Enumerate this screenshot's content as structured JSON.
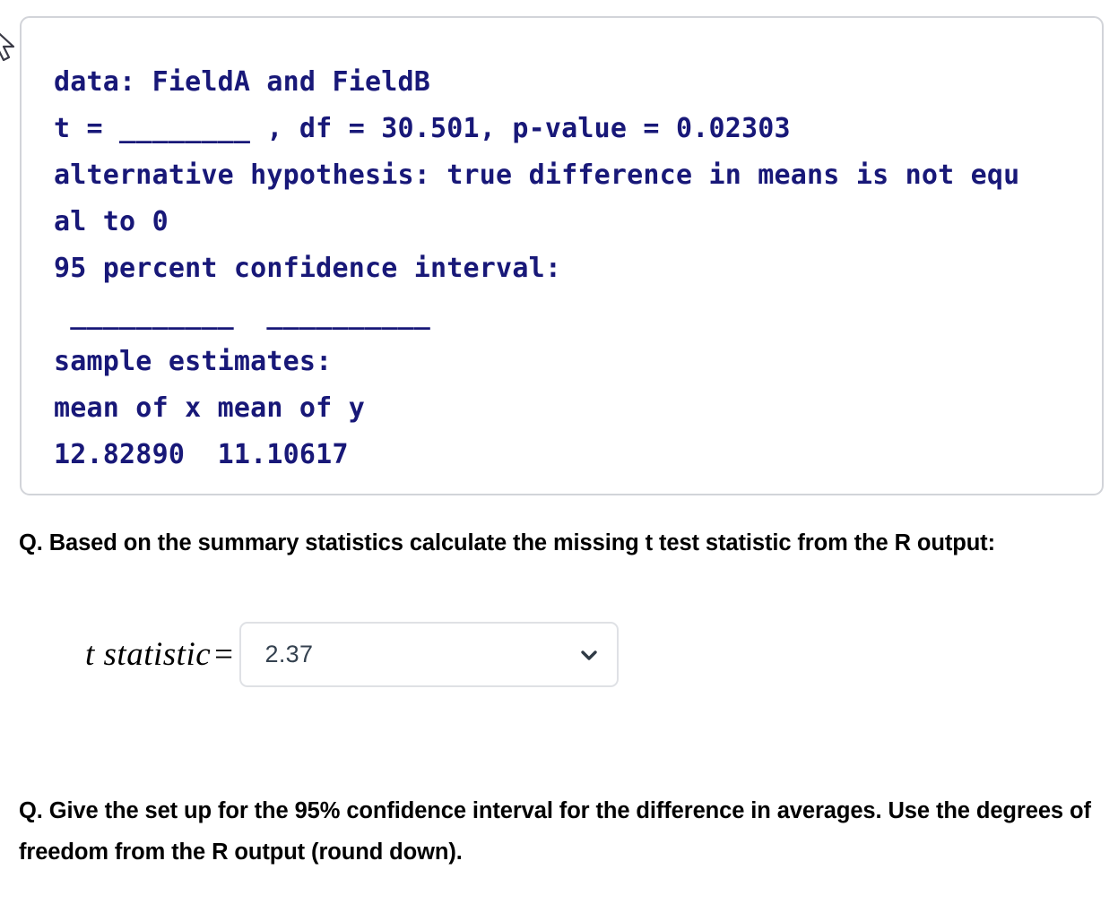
{
  "r_output": {
    "lines": [
      "data: FieldA and FieldB",
      "t = ________ , df = 30.501, p-value = 0.02303",
      "alternative hypothesis: true difference in means is not equ",
      "al to 0",
      "95 percent confidence interval:",
      " __________  __________",
      "sample estimates:",
      "mean of x mean of y",
      "12.82890  11.10617"
    ],
    "values": {
      "data_label": "data: FieldA and FieldB",
      "t_statistic_blank": "________",
      "df": "30.501",
      "p_value": "0.02303",
      "alternative_hypothesis": "true difference in means is not equal to 0",
      "confidence_level": "95 percent confidence interval:",
      "ci_lower_blank": "__________",
      "ci_upper_blank": "__________",
      "sample_estimates_label": "sample estimates:",
      "mean_x_label": "mean of x",
      "mean_y_label": "mean of y",
      "mean_x": "12.82890",
      "mean_y": "11.10617"
    },
    "text_color": "#181878",
    "border_color": "#d2d4d9"
  },
  "questions": {
    "one": "Q. Based on the summary statistics calculate the missing t test statistic from the R output:",
    "two": "Q. Give the set up for the 95% confidence interval for the difference in averages. Use the degrees of freedom from the R output (round down)."
  },
  "answer": {
    "math_label": "t statistic",
    "equals_sign": "=",
    "selected_value": "2.37",
    "value_color": "#354250",
    "border_color": "#dfe1e5",
    "chevron_icon": "chevron-down-icon"
  }
}
